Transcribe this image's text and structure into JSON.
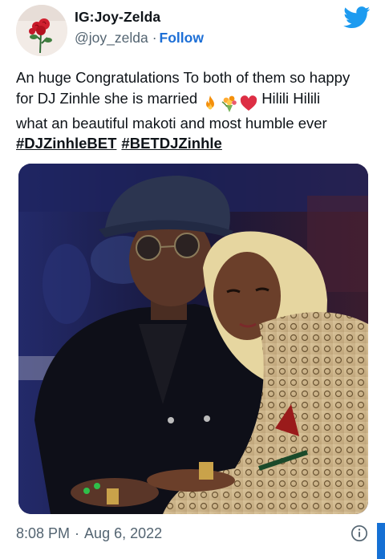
{
  "author": {
    "display_name": "IG:Joy-Zelda",
    "handle": "@joy_zelda",
    "separator": "·",
    "follow_label": "Follow",
    "avatar_icon": "rose-avatar-icon"
  },
  "tweet": {
    "line1": "An huge Congratulations To both of them so happy",
    "line2_before_emoji": "for DJ Zinhle she is married",
    "line2_after_emoji": "Hilili Hilili",
    "line3": "what an beautiful makoti and most humble ever",
    "hashtags": [
      "#DJZinhleBET",
      "#BETDJZinhle"
    ],
    "emojis": [
      "fire-emoji",
      "bouquet-emoji",
      "red-heart-emoji"
    ]
  },
  "meta": {
    "time": "8:08 PM",
    "separator": "·",
    "date": "Aug 6, 2022"
  },
  "colors": {
    "twitter_blue": "#1d9bf0",
    "follow_blue": "#1d6fd6",
    "secondary_text": "#536471",
    "primary_text": "#0f1419"
  }
}
